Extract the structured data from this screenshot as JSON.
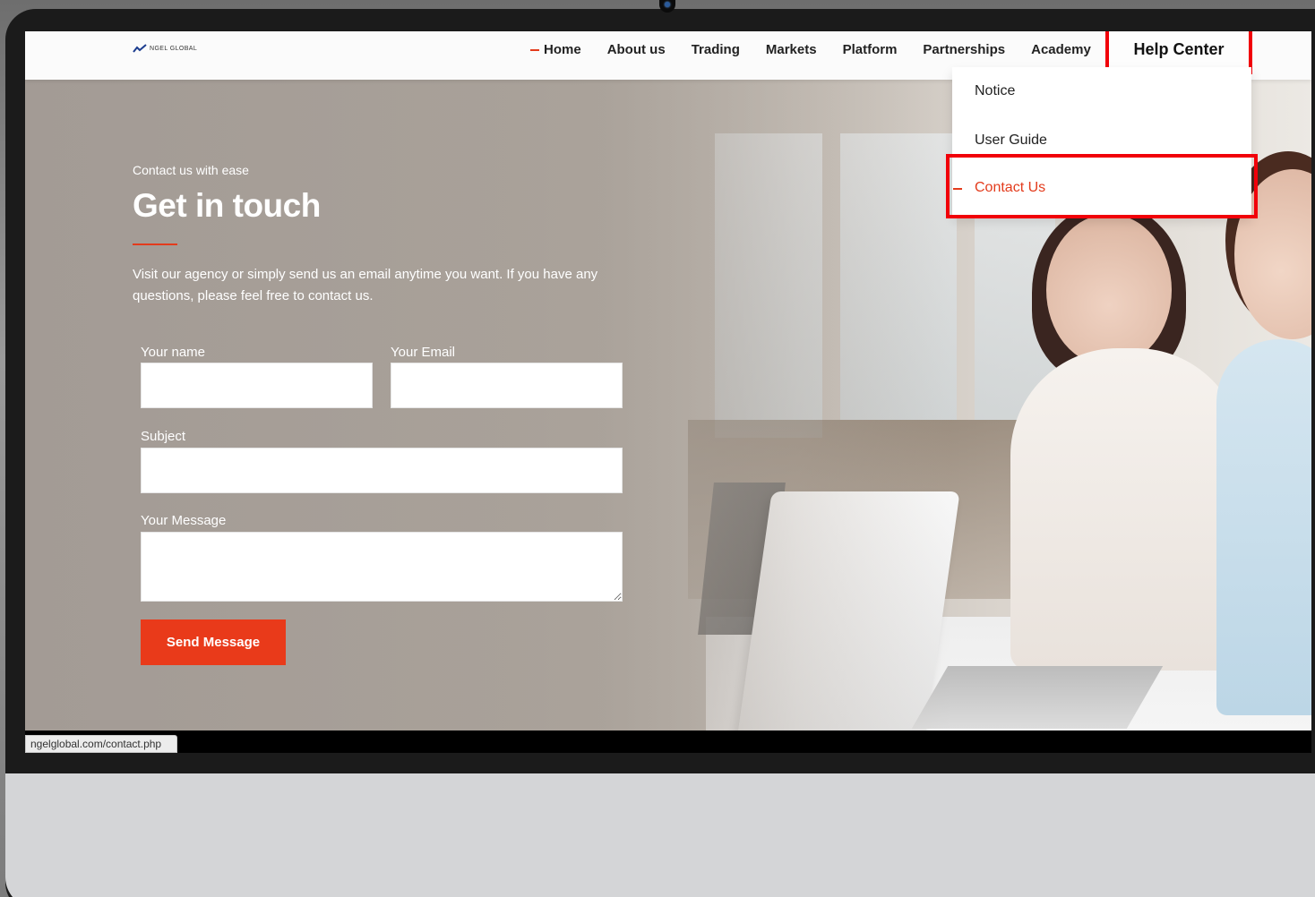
{
  "navbar": {
    "logo_text": "NGEL GLOBAL",
    "items": [
      {
        "label": "Home",
        "active": true
      },
      {
        "label": "About us"
      },
      {
        "label": "Trading"
      },
      {
        "label": "Markets"
      },
      {
        "label": "Platform"
      },
      {
        "label": "Partnerships"
      },
      {
        "label": "Academy"
      }
    ],
    "help_center": "Help Center"
  },
  "dropdown": {
    "items": [
      "Notice",
      "User Guide",
      "Contact Us"
    ]
  },
  "hero": {
    "eyebrow": "Contact us with ease",
    "title": "Get in touch",
    "intro": "Visit our agency or simply send us an email anytime you want. If you have any questions, please feel free to contact us."
  },
  "form": {
    "name_label": "Your name",
    "email_label": "Your Email",
    "subject_label": "Subject",
    "message_label": "Your Message",
    "name_value": "",
    "email_value": "",
    "subject_value": "",
    "message_value": "",
    "submit_label": "Send Message"
  },
  "status_bar": {
    "url": "ngelglobal.com/contact.php"
  },
  "colors": {
    "accent": "#e93a1a",
    "highlight": "#f10009"
  }
}
